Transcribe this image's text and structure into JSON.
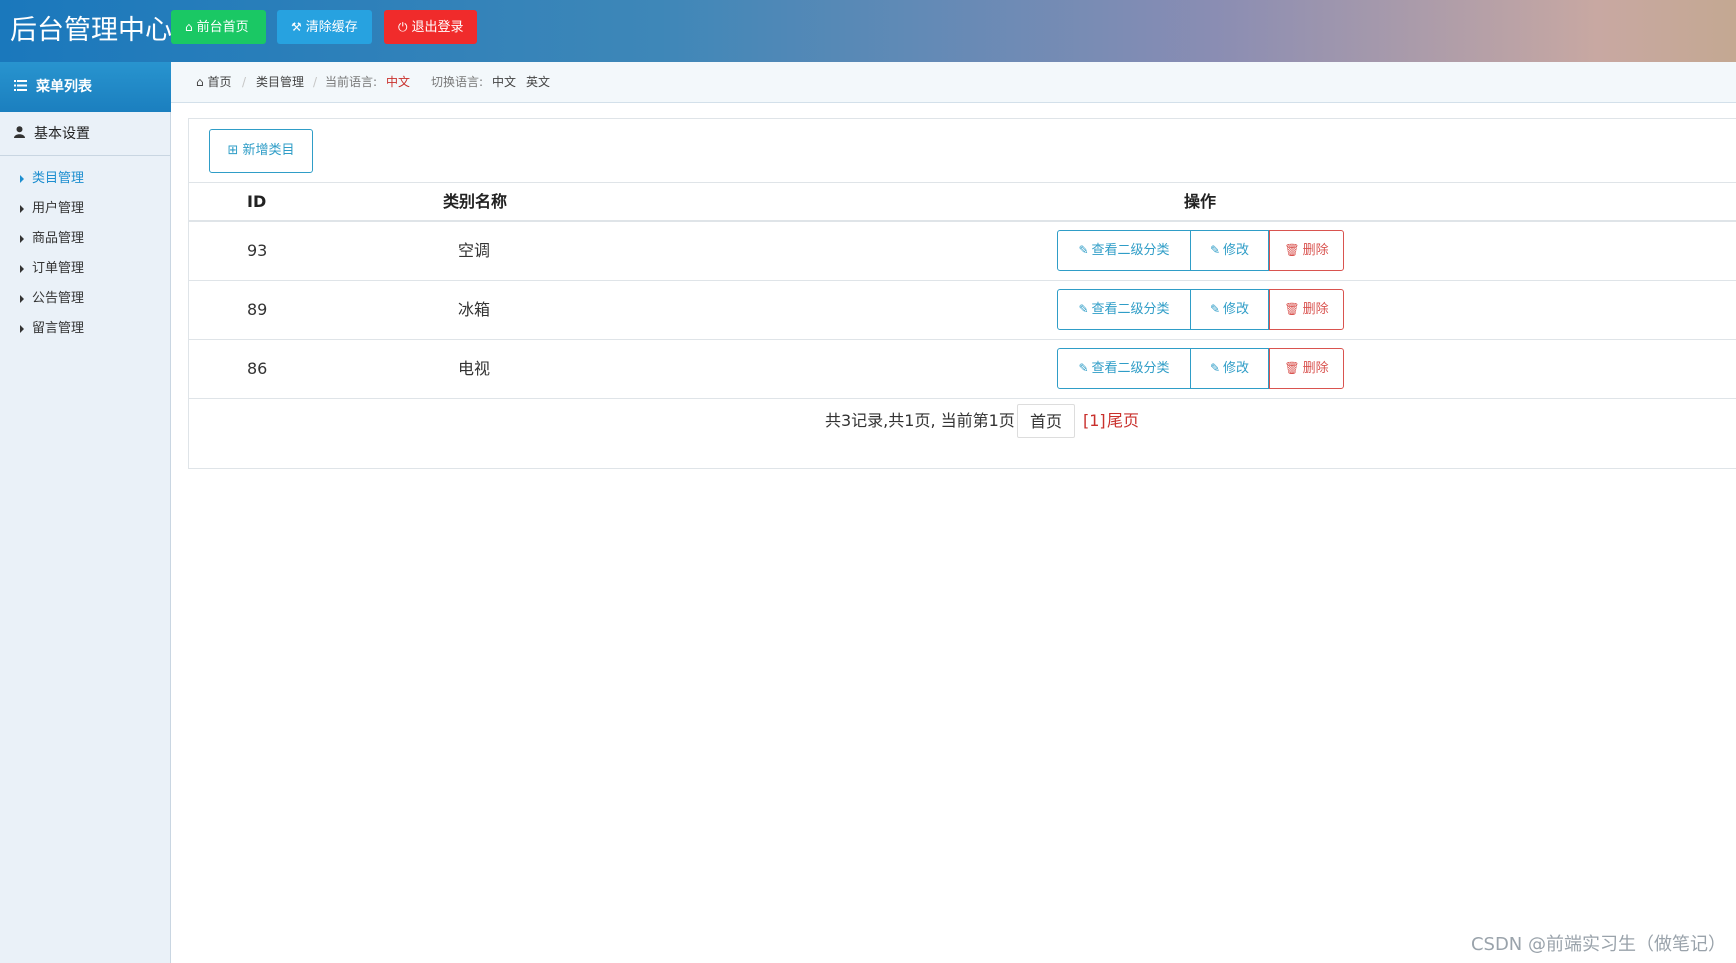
{
  "header": {
    "brand": "后台管理中心",
    "buttons": [
      {
        "label": "前台首页",
        "icon": "home-icon"
      },
      {
        "label": "清除缓存",
        "icon": "wrench-icon"
      },
      {
        "label": "退出登录",
        "icon": "power-icon"
      }
    ]
  },
  "sidebar": {
    "title": "菜单列表",
    "group": "基本设置",
    "items": [
      {
        "label": "类目管理"
      },
      {
        "label": "用户管理"
      },
      {
        "label": "商品管理"
      },
      {
        "label": "订单管理"
      },
      {
        "label": "公告管理"
      },
      {
        "label": "留言管理"
      }
    ]
  },
  "breadcrumb": {
    "home": "首页",
    "current": "类目管理",
    "lang_label": "当前语言:",
    "lang_value": "中文",
    "switch_label": "切换语言:",
    "switch_cn": "中文",
    "switch_en": "英文"
  },
  "content": {
    "add_button": "新增类目",
    "columns": [
      "ID",
      "类别名称",
      "操作"
    ],
    "rows": [
      {
        "id": "93",
        "name": "空调"
      },
      {
        "id": "89",
        "name": "冰箱"
      },
      {
        "id": "86",
        "name": "电视"
      }
    ],
    "actions": {
      "view": "查看二级分类",
      "edit": "修改",
      "delete": "删除"
    },
    "pager": {
      "summary": "共3记录,共1页, 当前第1页",
      "first": "首页",
      "current": "[1]",
      "last": "尾页"
    }
  },
  "watermark": "CSDN @前端实习生（做笔记）",
  "colors": {
    "accent": "#1d8ecf",
    "green": "#1ac864",
    "blue": "#27a2e0",
    "red": "#f02b2b",
    "delete": "#d9534f"
  }
}
